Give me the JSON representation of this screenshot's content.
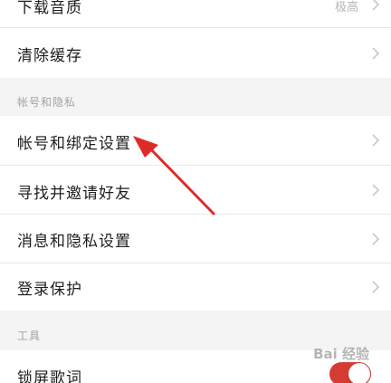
{
  "settings": {
    "download_quality": {
      "label": "下载音质",
      "value": "极高"
    },
    "clear_cache": {
      "label": "清除缓存"
    },
    "section_account": {
      "title": "帐号和隐私"
    },
    "account_binding": {
      "label": "帐号和绑定设置"
    },
    "find_friends": {
      "label": "寻找并邀请好友"
    },
    "message_privacy": {
      "label": "消息和隐私设置"
    },
    "login_protection": {
      "label": "登录保护"
    },
    "section_tools": {
      "title": "工具"
    },
    "lock_screen_lyrics": {
      "label": "锁屏歌词",
      "enabled": true
    }
  },
  "colors": {
    "accent": "#d43c33",
    "annotation_arrow": "#e02a2a"
  },
  "watermark": {
    "text": "Bai 经验"
  }
}
